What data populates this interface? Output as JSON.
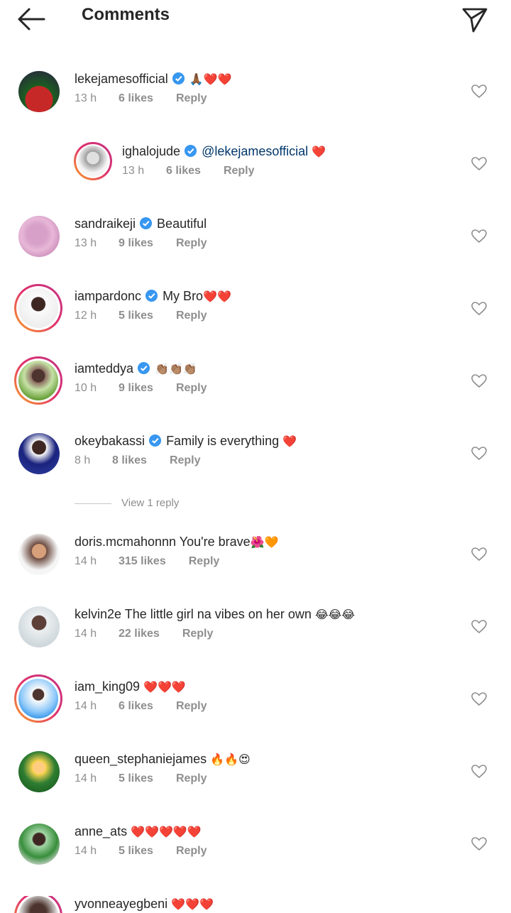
{
  "header": {
    "title": "Comments"
  },
  "comments": [
    {
      "user": "lekejamesofficial",
      "verified": true,
      "text": "",
      "emoji": "🙏🏾❤️❤️",
      "time": "13 h",
      "likes": "6 likes",
      "reply": "Reply"
    },
    {
      "user": "ighalojude",
      "verified": true,
      "text": "@lekejamesofficial",
      "emoji": " ❤️",
      "time": "13 h",
      "likes": "6 likes",
      "reply": "Reply"
    },
    {
      "user": "sandraikeji",
      "verified": true,
      "text": "Beautiful",
      "emoji": "",
      "time": "13 h",
      "likes": "9 likes",
      "reply": "Reply"
    },
    {
      "user": "iampardonc",
      "verified": true,
      "text": "My Bro",
      "emoji": "❤️❤️",
      "time": "12 h",
      "likes": "5 likes",
      "reply": "Reply"
    },
    {
      "user": "iamteddya",
      "verified": true,
      "text": "",
      "emoji": "👏🏽👏🏽👏🏽",
      "time": "10 h",
      "likes": "9 likes",
      "reply": "Reply"
    },
    {
      "user": "okeybakassi",
      "verified": true,
      "text": "Family is everything",
      "emoji": " ❤️",
      "time": "8 h",
      "likes": "8 likes",
      "reply": "Reply"
    },
    {
      "user": "doris.mcmahonnn",
      "verified": false,
      "text": "You're brave",
      "emoji": "🌺🧡",
      "time": "14 h",
      "likes": "315 likes",
      "reply": "Reply"
    },
    {
      "user": "kelvin2e",
      "verified": false,
      "text": "The little girl na vibes on her own",
      "emoji": " 😂😂😂",
      "time": "14 h",
      "likes": "22 likes",
      "reply": "Reply"
    },
    {
      "user": "iam_king09",
      "verified": false,
      "text": "",
      "emoji": "❤️❤️❤️",
      "time": "14 h",
      "likes": "6 likes",
      "reply": "Reply"
    },
    {
      "user": "queen_stephaniejames",
      "verified": false,
      "text": "",
      "emoji": "🔥🔥😍",
      "time": "14 h",
      "likes": "5 likes",
      "reply": "Reply"
    },
    {
      "user": "anne_ats",
      "verified": false,
      "text": "",
      "emoji": "❤️❤️❤️❤️❤️",
      "time": "14 h",
      "likes": "5 likes",
      "reply": "Reply"
    },
    {
      "user": "yvonneayegbeni",
      "verified": false,
      "text": "",
      "emoji": "❤️❤️❤️",
      "time": "",
      "likes": "",
      "reply": ""
    }
  ],
  "view_replies": "View 1 reply",
  "colors": {
    "verified": "#3897f0",
    "secondary": "#8e8e8e",
    "mention": "#00376b",
    "heart": "#ed4956"
  }
}
